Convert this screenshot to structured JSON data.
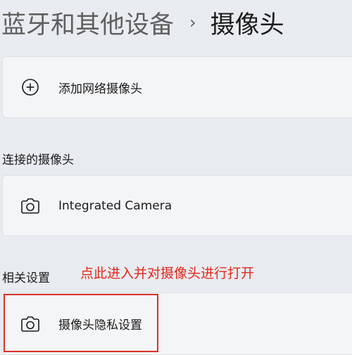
{
  "breadcrumb": {
    "parent": "蓝牙和其他设备",
    "separator": "›",
    "current": "摄像头"
  },
  "add_network_camera": {
    "icon": "plus-circle-icon",
    "label": "添加网络摄像头"
  },
  "connected_section": {
    "title": "连接的摄像头",
    "cameras": [
      {
        "icon": "camera-icon",
        "label": "Integrated Camera"
      }
    ]
  },
  "related_section": {
    "title": "相关设置",
    "items": [
      {
        "icon": "camera-icon",
        "label": "摄像头隐私设置"
      }
    ]
  },
  "annotation": {
    "text": "点此进入并对摄像头进行打开",
    "color": "#e3271c"
  }
}
